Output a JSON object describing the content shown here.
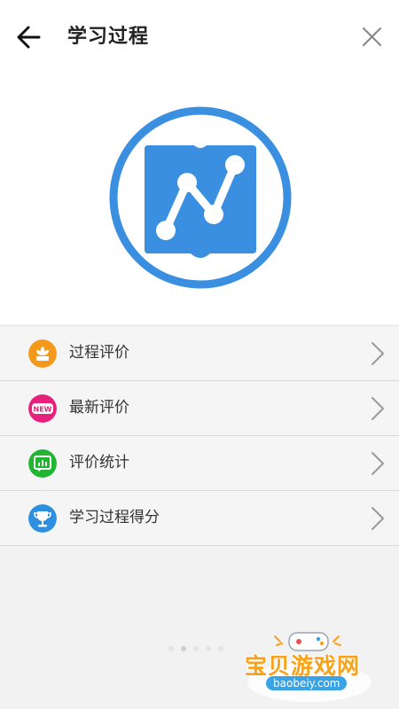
{
  "header": {
    "title": "学习过程",
    "back_icon": "arrow-left-icon",
    "close_icon": "close-icon"
  },
  "hero": {
    "logo_icon": "learning-process-logo-icon",
    "accent_color": "#3a8fe0"
  },
  "menu": {
    "items": [
      {
        "label": "过程评价",
        "icon": "flower-icon",
        "color": "#f39a1c"
      },
      {
        "label": "最新评价",
        "icon": "new-badge-icon",
        "icon_text": "NEW",
        "color": "#e6207c"
      },
      {
        "label": "评价统计",
        "icon": "chart-monitor-icon",
        "color": "#22b531"
      },
      {
        "label": "学习过程得分",
        "icon": "trophy-icon",
        "color": "#2c8fe0"
      }
    ],
    "chevron_icon": "chevron-right-icon"
  },
  "pager": {
    "count": 5,
    "active": 1
  },
  "watermark": {
    "text": "宝贝游戏网",
    "url": "baobeiy.com",
    "icon": "gamepad-icon"
  }
}
